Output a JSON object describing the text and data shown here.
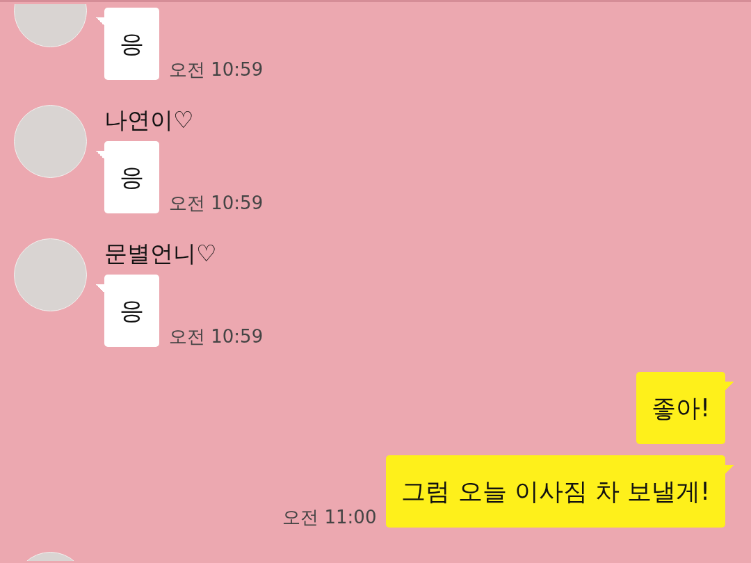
{
  "messages": [
    {
      "kind": "incoming",
      "avatar": true,
      "text": "응",
      "time": "오전 10:59"
    },
    {
      "kind": "incoming",
      "avatar": true,
      "name": "나연이♡",
      "text": "응",
      "time": "오전 10:59"
    },
    {
      "kind": "incoming",
      "avatar": true,
      "name": "문별언니♡",
      "text": "응",
      "time": "오전 10:59"
    },
    {
      "kind": "outgoing",
      "text": "좋아!"
    },
    {
      "kind": "outgoing",
      "text": "그럼 오늘 이사짐 차 보낼게!",
      "time": "오전 11:00"
    },
    {
      "kind": "avatar_only",
      "avatar": true
    }
  ]
}
